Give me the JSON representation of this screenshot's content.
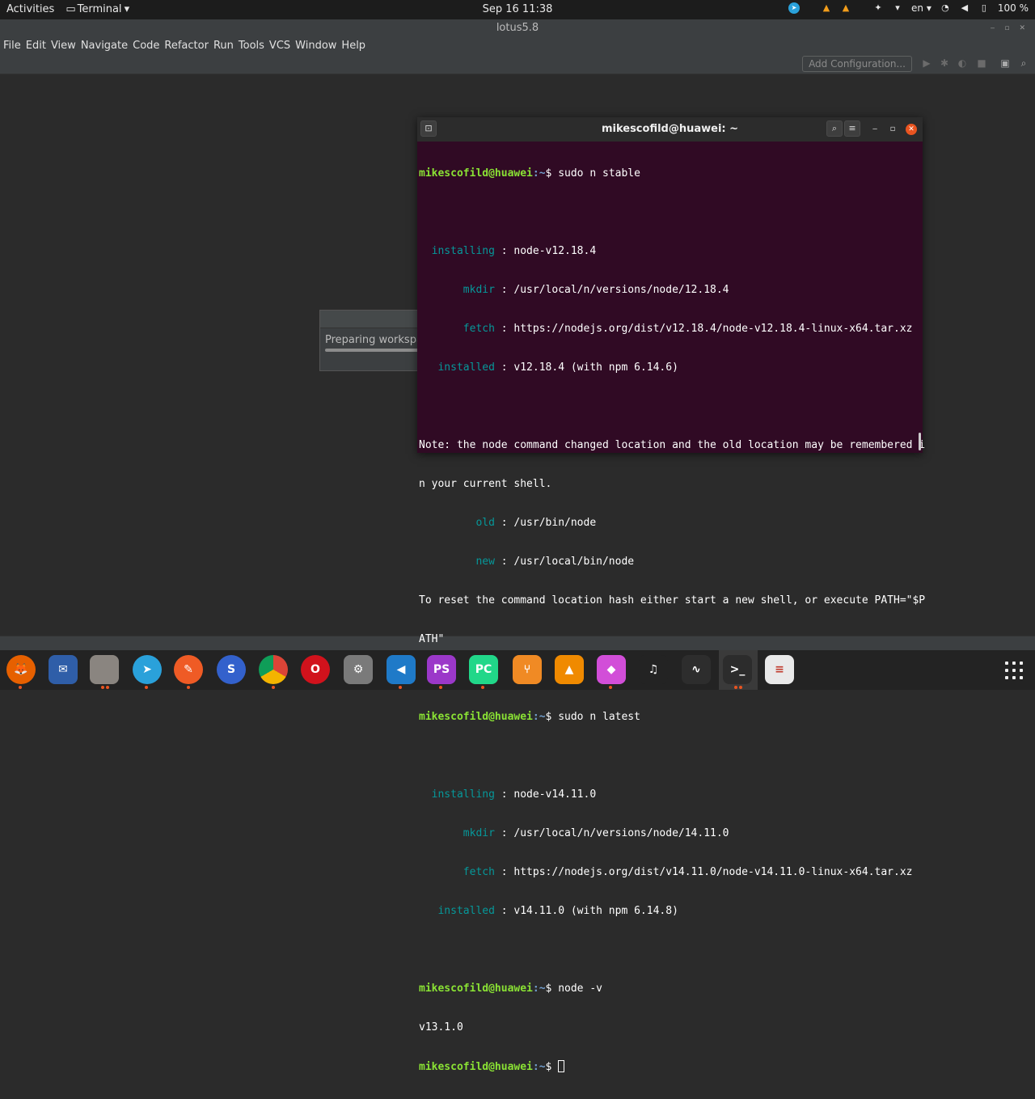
{
  "topbar": {
    "activities": "Activities",
    "app_menu": "Terminal",
    "app_menu_arrow": "▾",
    "clock": "Sep 16  11:38",
    "lang": "en",
    "battery": "100 %"
  },
  "ide": {
    "title": "lotus5.8",
    "menu": [
      "File",
      "Edit",
      "View",
      "Navigate",
      "Code",
      "Refactor",
      "Run",
      "Tools",
      "VCS",
      "Window",
      "Help"
    ],
    "add_configuration": "Add Configuration..."
  },
  "dialog": {
    "message": "Preparing workspac"
  },
  "terminal": {
    "title": "mikescofild@huawei: ~",
    "prompt_user": "mikescofild@huawei",
    "prompt_path": ":~",
    "lines": {
      "l1_cmd": "$ sudo n stable",
      "l3_label": "  installing",
      "l3_text": " : node-v12.18.4",
      "l4_label": "       mkdir",
      "l4_text": " : /usr/local/n/versions/node/12.18.4",
      "l5_label": "       fetch",
      "l5_text": " : https://nodejs.org/dist/v12.18.4/node-v12.18.4-linux-x64.tar.xz",
      "l6_label": "   installed",
      "l6_text": " : v12.18.4 (with npm 6.14.6)",
      "l8": "Note: the node command changed location and the old location may be remembered i",
      "l9": "n your current shell.",
      "l10_label": "         old",
      "l10_text": " : /usr/bin/node",
      "l11_label": "         new",
      "l11_text": " : /usr/local/bin/node",
      "l12": "To reset the command location hash either start a new shell, or execute PATH=\"$P",
      "l13": "ATH\"",
      "l15_cmd": "$ sudo n latest",
      "l17_label": "  installing",
      "l17_text": " : node-v14.11.0",
      "l18_label": "       mkdir",
      "l18_text": " : /usr/local/n/versions/node/14.11.0",
      "l19_label": "       fetch",
      "l19_text": " : https://nodejs.org/dist/v14.11.0/node-v14.11.0-linux-x64.tar.xz",
      "l20_label": "   installed",
      "l20_text": " : v14.11.0 (with npm 6.14.8)",
      "l22_cmd": "$ node -v",
      "l23": "v13.1.0",
      "l24_cmd": "$ "
    }
  },
  "dock": {
    "items": [
      {
        "name": "firefox",
        "glyph": "🦊",
        "color": "#e66000"
      },
      {
        "name": "thunderbird",
        "glyph": "✉",
        "color": "#2f5ea8"
      },
      {
        "name": "files",
        "glyph": "",
        "color": "#8a8580"
      },
      {
        "name": "telegram",
        "glyph": "➤",
        "color": "#2aa1da"
      },
      {
        "name": "postman",
        "glyph": "✎",
        "color": "#ef5b25"
      },
      {
        "name": "simplenote",
        "glyph": "S",
        "color": "#3361cc"
      },
      {
        "name": "chrome",
        "glyph": "",
        "color": "#4285f4"
      },
      {
        "name": "opera",
        "glyph": "O",
        "color": "#d1121c"
      },
      {
        "name": "settings",
        "glyph": "⚙",
        "color": "#7a7a7a"
      },
      {
        "name": "vscode",
        "glyph": "◀",
        "color": "#1f7ac8"
      },
      {
        "name": "phpstorm",
        "glyph": "PS",
        "color": "#9b38c9"
      },
      {
        "name": "pycharm",
        "glyph": "PC",
        "color": "#21d789"
      },
      {
        "name": "sublime-merge",
        "glyph": "⑂",
        "color": "#f08a24"
      },
      {
        "name": "vlc",
        "glyph": "▲",
        "color": "#f08a00"
      },
      {
        "name": "kite",
        "glyph": "◆",
        "color": "#d24ed8"
      },
      {
        "name": "music",
        "glyph": "♫",
        "color": "#232323"
      },
      {
        "name": "system-monitor",
        "glyph": "∿",
        "color": "#2d2d2d"
      },
      {
        "name": "terminal",
        "glyph": ">_",
        "color": "#2c2c2c"
      },
      {
        "name": "document-viewer",
        "glyph": "≡",
        "color": "#e9e9e9"
      }
    ]
  }
}
